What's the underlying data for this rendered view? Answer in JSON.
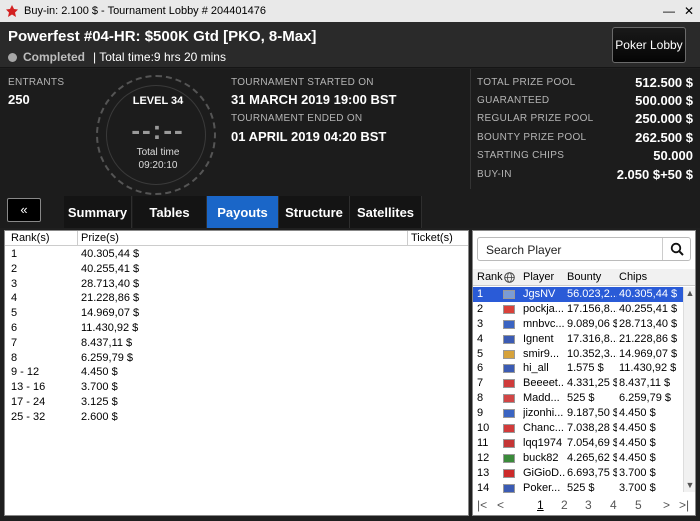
{
  "window": {
    "title": "Buy-in: 2.100 $ - Tournament Lobby # 204401476",
    "minimize": "—",
    "close": "✕"
  },
  "header": {
    "name": "Powerfest #04-HR: $500K Gtd [PKO, 8-Max]",
    "status": "Completed",
    "total_time": "| Total time:9 hrs  20 mins",
    "lobby_button": "Poker Lobby"
  },
  "info": {
    "entrants_label": "ENTRANTS",
    "entrants": "250",
    "level": "LEVEL 34",
    "clock_digits": "--:--",
    "total_time_label": "Total time",
    "total_time_value": "09:20:10",
    "started_label": "TOURNAMENT STARTED ON",
    "started": "31 MARCH 2019  19:00 BST",
    "ended_label": "TOURNAMENT ENDED ON",
    "ended": "01 APRIL 2019  04:20 BST"
  },
  "prizes": [
    {
      "label": "TOTAL PRIZE POOL",
      "value": "512.500 $"
    },
    {
      "label": "GUARANTEED",
      "value": "500.000 $"
    },
    {
      "label": "REGULAR PRIZE POOL",
      "value": "250.000 $"
    },
    {
      "label": "BOUNTY PRIZE POOL",
      "value": "262.500 $"
    },
    {
      "label": "STARTING CHIPS",
      "value": "50.000"
    },
    {
      "label": "BUY-IN",
      "value": "2.050 $+50 $"
    }
  ],
  "tabs": {
    "collapse": "«",
    "items": [
      "Summary",
      "Tables",
      "Payouts",
      "Structure",
      "Satellites"
    ],
    "active": "Payouts"
  },
  "payouts": {
    "headers": [
      "Rank(s)",
      "Prize(s)",
      "Ticket(s)"
    ],
    "rows": [
      [
        "1",
        "40.305,44 $"
      ],
      [
        "2",
        "40.255,41 $"
      ],
      [
        "3",
        "28.713,40 $"
      ],
      [
        "4",
        "21.228,86 $"
      ],
      [
        "5",
        "14.969,07 $"
      ],
      [
        "6",
        "11.430,92 $"
      ],
      [
        "7",
        "8.437,11 $"
      ],
      [
        "8",
        "6.259,79 $"
      ],
      [
        "9 - 12",
        "4.450 $"
      ],
      [
        "13 - 16",
        "3.700 $"
      ],
      [
        "17 - 24",
        "3.125 $"
      ],
      [
        "25 - 32",
        "2.600 $"
      ]
    ]
  },
  "players": {
    "search_placeholder": "Search Player",
    "headers": [
      "Rank",
      "Player",
      "Bounty",
      "Chips"
    ],
    "rows": [
      [
        "1",
        "JgsNV",
        "56.023,2...",
        "40.305,44 $"
      ],
      [
        "2",
        "pockja...",
        "17.156,8...",
        "40.255,41 $"
      ],
      [
        "3",
        "mnbvc...",
        "9.089,06 $",
        "28.713,40 $"
      ],
      [
        "4",
        "Ignent",
        "17.316,8...",
        "21.228,86 $"
      ],
      [
        "5",
        "smir9...",
        "10.352,3...",
        "14.969,07 $"
      ],
      [
        "6",
        "hi_all",
        "1.575 $",
        "11.430,92 $"
      ],
      [
        "7",
        "Beeeet...",
        "4.331,25 $",
        "8.437,11 $"
      ],
      [
        "8",
        "Madd...",
        "525 $",
        "6.259,79 $"
      ],
      [
        "9",
        "jizonhi...",
        "9.187,50 $",
        "4.450 $"
      ],
      [
        "10",
        "Chanc...",
        "7.038,28 $",
        "4.450 $"
      ],
      [
        "11",
        "lqq1974",
        "7.054,69 $",
        "4.450 $"
      ],
      [
        "12",
        "buck82",
        "4.265,62 $",
        "4.450 $"
      ],
      [
        "13",
        "GiGioD...",
        "6.693,75 $",
        "3.700 $"
      ],
      [
        "14",
        "Poker...",
        "525 $",
        "3.700 $"
      ]
    ],
    "flags": [
      "#7a9cd6",
      "#d9413a",
      "#3a64c2",
      "#3b5bb3",
      "#d6a23b",
      "#3b5bb3",
      "#cf3b3b",
      "#d14545",
      "#3a64c2",
      "#d13a3a",
      "#c43535",
      "#3a8a3a",
      "#cc2a2a",
      "#3b5bb3"
    ],
    "pager": [
      "|<",
      "<",
      "1",
      "2",
      "3",
      "4",
      "5",
      ">",
      ">|"
    ]
  },
  "colors": {
    "accent": "#1a66c8",
    "selection": "#2a5bd7"
  }
}
